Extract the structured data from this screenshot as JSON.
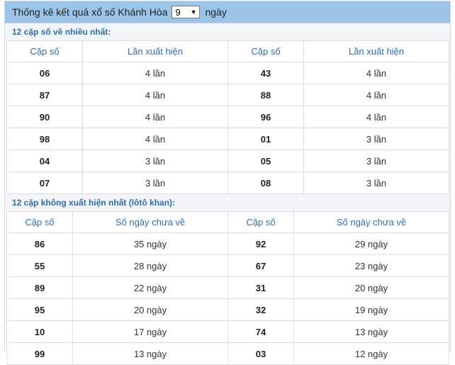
{
  "header": {
    "prefix": "Thống kê kết quả xổ số Khánh Hòa",
    "days_value": "9",
    "dropdown_arrow": "▼",
    "suffix": "ngày"
  },
  "most_section": {
    "title": "12 cặp số về nhiều nhất:",
    "col_pair": "Cặp số",
    "col_count": "Lần xuất hiện",
    "rows": [
      [
        "06",
        "4 lần",
        "43",
        "4 lần"
      ],
      [
        "87",
        "4 lần",
        "88",
        "4 lần"
      ],
      [
        "90",
        "4 lần",
        "96",
        "4 lần"
      ],
      [
        "98",
        "4 lần",
        "01",
        "3 lần"
      ],
      [
        "04",
        "3 lần",
        "05",
        "3 lần"
      ],
      [
        "07",
        "3 lần",
        "08",
        "3 lần"
      ]
    ]
  },
  "absent_section": {
    "title": "12 cặp không xuất hiện nhất (lôtô khan):",
    "col_pair": "Cặp số",
    "col_days": "Số ngày chưa về",
    "rows": [
      [
        "86",
        "35 ngày",
        "92",
        "29 ngày"
      ],
      [
        "55",
        "28 ngày",
        "67",
        "23 ngày"
      ],
      [
        "89",
        "22 ngày",
        "31",
        "20 ngày"
      ],
      [
        "95",
        "20 ngày",
        "32",
        "19 ngày"
      ],
      [
        "10",
        "17 ngày",
        "74",
        "13 ngày"
      ],
      [
        "99",
        "13 ngày",
        "03",
        "12 ngày"
      ]
    ]
  }
}
